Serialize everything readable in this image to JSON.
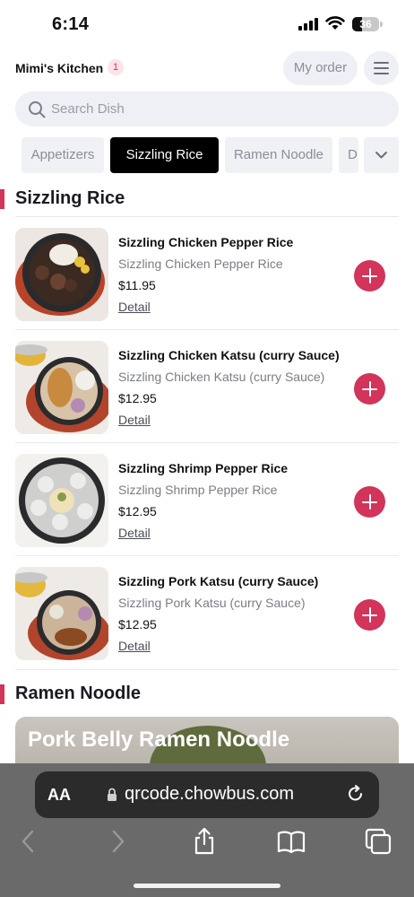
{
  "status": {
    "time": "6:14",
    "battery": "36",
    "battery_level": 0.36
  },
  "header": {
    "store_name": "Mimi's Kitchen",
    "badge": "1",
    "my_order": "My order"
  },
  "search": {
    "placeholder": "Search Dish",
    "value": ""
  },
  "tabs": [
    {
      "label": "Appetizers",
      "active": false
    },
    {
      "label": "Sizzling Rice",
      "active": true
    },
    {
      "label": "Ramen Noodle",
      "active": false
    },
    {
      "label": "D",
      "active": false
    }
  ],
  "sections": [
    {
      "title": "Sizzling Rice",
      "dishes": [
        {
          "name": "Sizzling Chicken Pepper Rice",
          "description": "Sizzling Chicken Pepper Rice",
          "price": "$11.95",
          "detail": "Detail"
        },
        {
          "name": "Sizzling Chicken Katsu (curry Sauce)",
          "description": "Sizzling Chicken Katsu (curry Sauce)",
          "price": "$12.95",
          "detail": "Detail"
        },
        {
          "name": "Sizzling Shrimp Pepper Rice",
          "description": "Sizzling Shrimp Pepper Rice",
          "price": "$12.95",
          "detail": "Detail"
        },
        {
          "name": "Sizzling Pork Katsu (curry Sauce)",
          "description": "Sizzling Pork Katsu (curry Sauce)",
          "price": "$12.95",
          "detail": "Detail"
        }
      ]
    },
    {
      "title": "Ramen Noodle",
      "feature": {
        "title": "Pork Belly Ramen Noodle"
      }
    }
  ],
  "browser": {
    "url": "qrcode.chowbus.com",
    "text_size_label": "AA"
  },
  "colors": {
    "accent": "#d2345a",
    "tab_active": "#000000",
    "pill_bg": "#eef0f5"
  }
}
